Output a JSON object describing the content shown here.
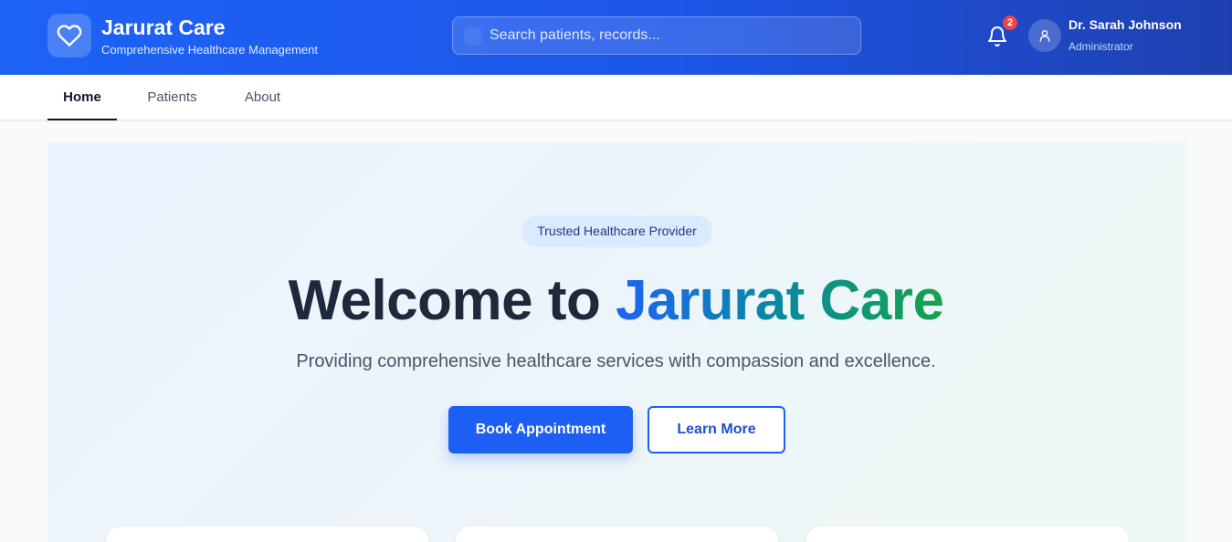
{
  "header": {
    "brand_title": "Jarurat Care",
    "brand_subtitle": "Comprehensive Healthcare Management",
    "logo_icon": "heart-icon",
    "search": {
      "placeholder": "Search patients, records...",
      "value": ""
    },
    "notifications": {
      "icon": "bell-icon",
      "count": "2"
    },
    "user": {
      "name": "Dr. Sarah Johnson",
      "role": "Administrator",
      "icon": "user-icon"
    }
  },
  "nav": {
    "tabs": [
      {
        "label": "Home",
        "active": true
      },
      {
        "label": "Patients",
        "active": false
      },
      {
        "label": "About",
        "active": false
      }
    ]
  },
  "hero": {
    "badge": "Trusted Healthcare Provider",
    "headline_prefix": "Welcome to ",
    "headline_highlight": "Jarurat Care",
    "tagline": "Providing comprehensive healthcare services with compassion and excellence.",
    "primary_button": "Book Appointment",
    "secondary_button": "Learn More"
  },
  "colors": {
    "primary": "#1d5ef5",
    "header_gradient_end": "#1e40af",
    "accent_green": "#16a34a",
    "badge_red": "#ef4444"
  }
}
